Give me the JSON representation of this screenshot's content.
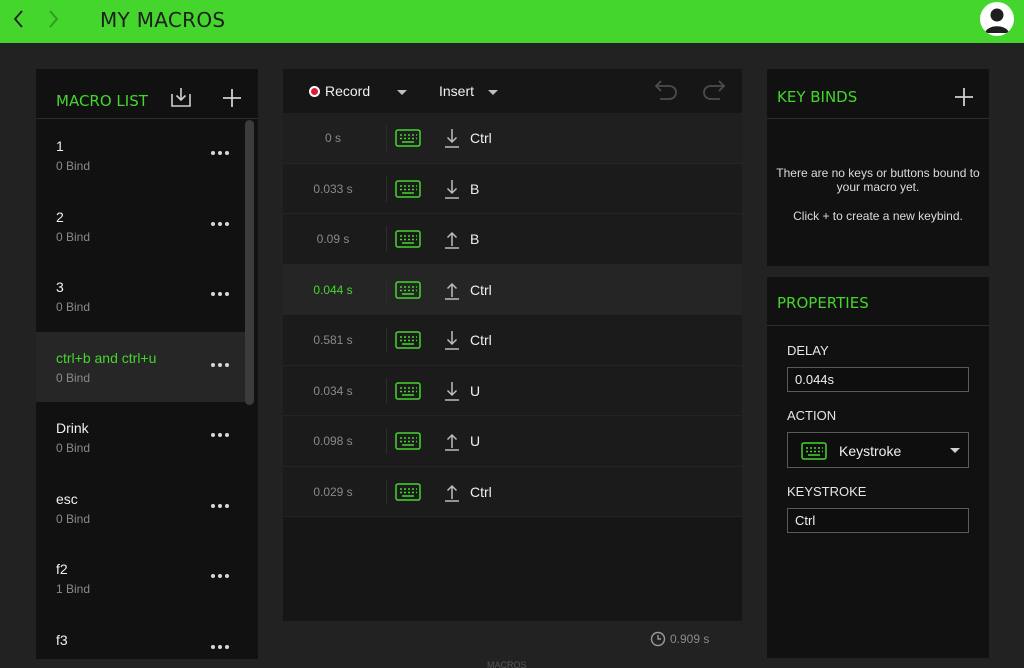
{
  "header": {
    "title": "MY MACROS",
    "back_icon": "chevron-left-icon",
    "forward_icon": "chevron-right-icon",
    "avatar_icon": "user-avatar-icon"
  },
  "colors": {
    "accent": "#44d62c",
    "record": "#e0193a"
  },
  "macro_list": {
    "title": "MACRO LIST",
    "import_icon": "import-icon",
    "add_icon": "plus-icon",
    "items": [
      {
        "name": "1",
        "binds": "0 Bind"
      },
      {
        "name": "2",
        "binds": "0 Bind"
      },
      {
        "name": "3",
        "binds": "0 Bind"
      },
      {
        "name": "ctrl+b and ctrl+u",
        "binds": "0 Bind"
      },
      {
        "name": "Drink",
        "binds": "0 Bind"
      },
      {
        "name": "esc",
        "binds": "0 Bind"
      },
      {
        "name": "f2",
        "binds": "1 Bind"
      },
      {
        "name": "f3",
        "binds": ""
      }
    ],
    "selected_index": 3
  },
  "sequence": {
    "record_label": "Record",
    "insert_label": "Insert",
    "undo_icon": "undo-icon",
    "redo_icon": "redo-icon",
    "rows": [
      {
        "time": "0 s",
        "direction": "down",
        "key": "Ctrl"
      },
      {
        "time": "0.033 s",
        "direction": "down",
        "key": "B"
      },
      {
        "time": "0.09 s",
        "direction": "up",
        "key": "B"
      },
      {
        "time": "0.044 s",
        "direction": "up",
        "key": "Ctrl"
      },
      {
        "time": "0.581 s",
        "direction": "down",
        "key": "Ctrl"
      },
      {
        "time": "0.034 s",
        "direction": "down",
        "key": "U"
      },
      {
        "time": "0.098 s",
        "direction": "up",
        "key": "U"
      },
      {
        "time": "0.029 s",
        "direction": "up",
        "key": "Ctrl"
      }
    ],
    "selected_index": 3,
    "total_time": "0.909 s"
  },
  "key_binds": {
    "title": "KEY BINDS",
    "empty_text": "There are no keys or buttons bound to your macro yet.",
    "hint_text": "Click + to create a new keybind."
  },
  "properties": {
    "title": "PROPERTIES",
    "delay_label": "DELAY",
    "delay_value": "0.044s",
    "action_label": "ACTION",
    "action_value": "Keystroke",
    "keystroke_label": "KEYSTROKE",
    "keystroke_value": "Ctrl"
  },
  "footer": {
    "hint": "MACROS"
  }
}
